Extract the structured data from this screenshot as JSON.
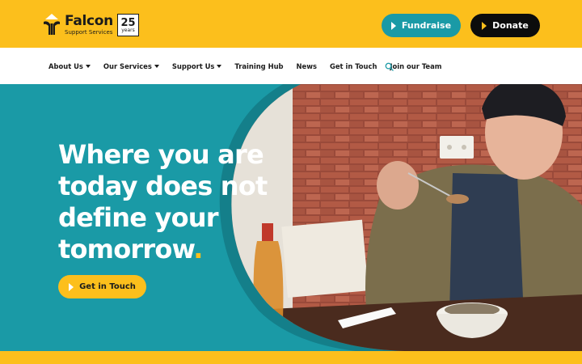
{
  "brand": {
    "name": "Falcon",
    "tagline": "Support Services",
    "badge_number": "25",
    "badge_text": "years"
  },
  "header": {
    "fundraise_label": "Fundraise",
    "donate_label": "Donate"
  },
  "nav": {
    "items": [
      {
        "label": "About Us",
        "dropdown": true
      },
      {
        "label": "Our Services",
        "dropdown": true
      },
      {
        "label": "Support Us",
        "dropdown": true
      },
      {
        "label": "Training Hub",
        "dropdown": false
      },
      {
        "label": "News",
        "dropdown": false
      },
      {
        "label": "Get in Touch",
        "dropdown": false
      },
      {
        "label": "Join our Team",
        "dropdown": false
      }
    ]
  },
  "hero": {
    "headline_lines": [
      "Where you are",
      "today does not",
      "define your",
      "tomorrow"
    ],
    "headline_period": ".",
    "cta_label": "Get in Touch"
  },
  "colors": {
    "brand_yellow": "#fcbf1c",
    "teal": "#1a9aa6",
    "dark": "#0c0c0c"
  }
}
